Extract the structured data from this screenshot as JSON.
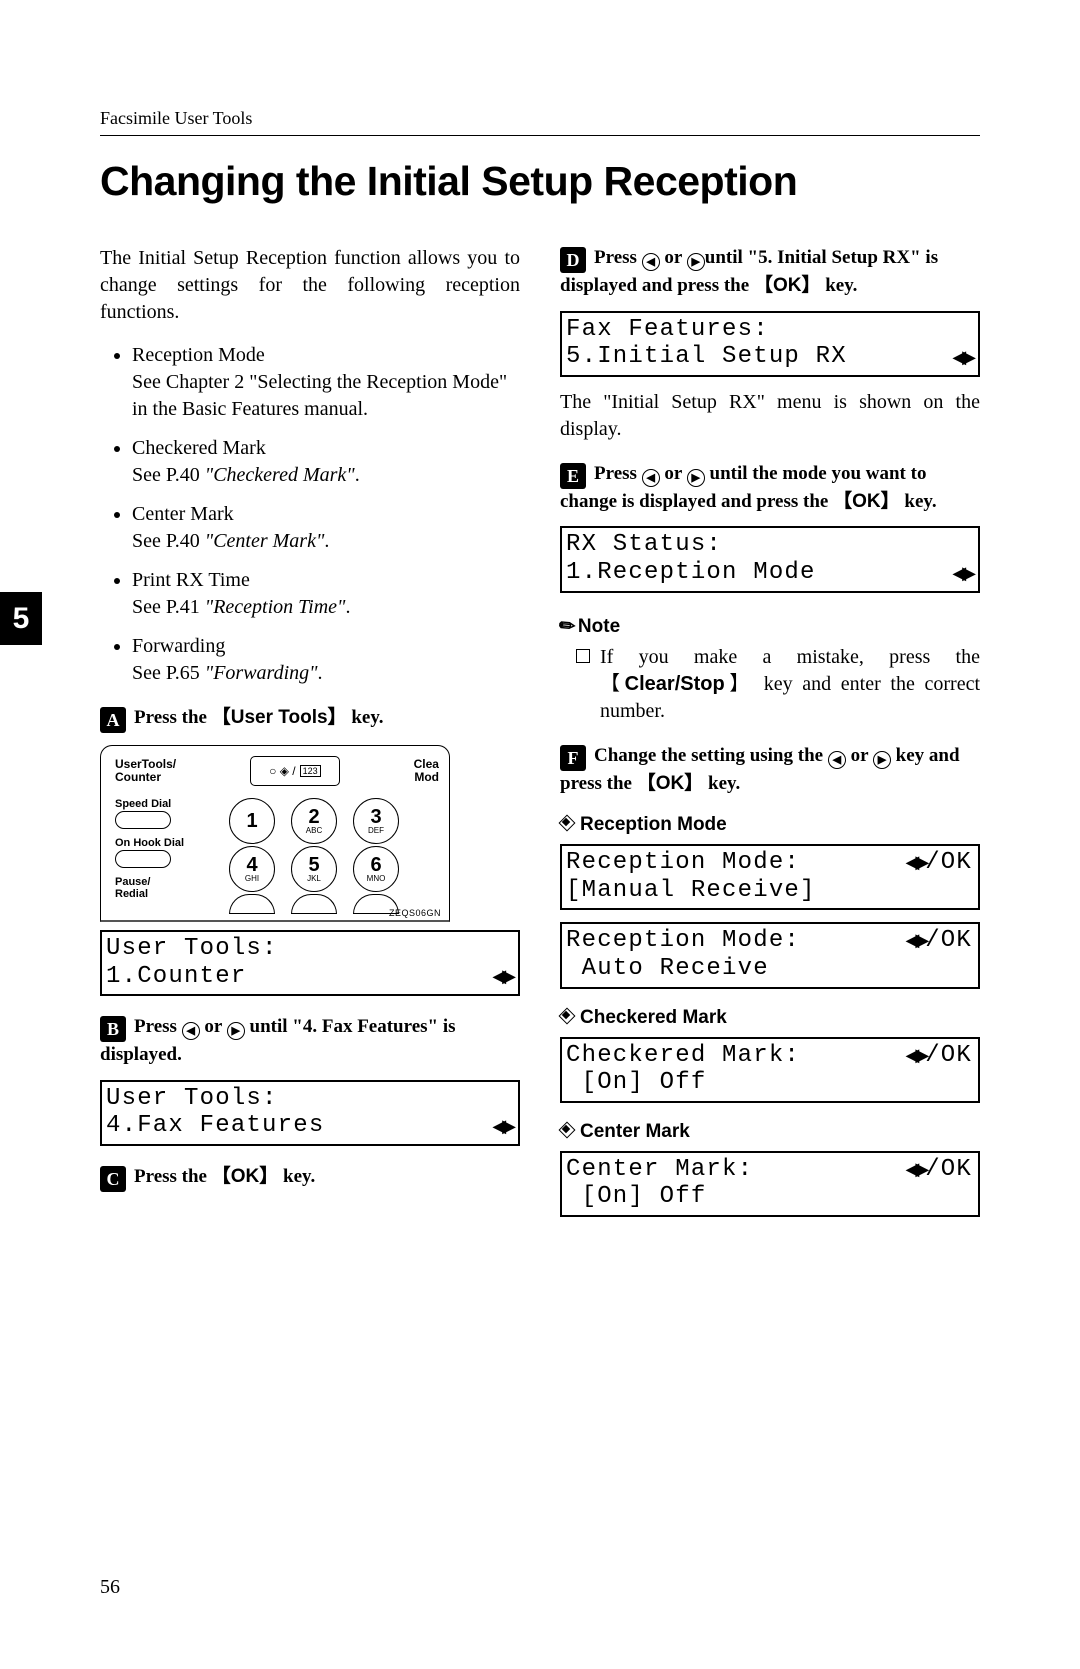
{
  "header": "Facsimile User Tools",
  "title": "Changing the Initial Setup Reception",
  "sideTab": "5",
  "pageNum": "56",
  "intro": "The Initial Setup Reception function allows you to change settings for the following reception functions.",
  "bullets": [
    {
      "t1": "Reception Mode",
      "t2": "See Chapter 2 \"Selecting the Reception Mode\" in the Basic Features manual."
    },
    {
      "t1": "Checkered Mark",
      "t2": "See P.40 ",
      "ref": "\"Checkered Mark\"",
      "t3": "."
    },
    {
      "t1": "Center Mark",
      "t2": "See P.40 ",
      "ref": "\"Center Mark\"",
      "t3": "."
    },
    {
      "t1": "Print RX Time",
      "t2": "See P.41 ",
      "ref": "\"Reception Time\"",
      "t3": "."
    },
    {
      "t1": "Forwarding",
      "t2": "See P.65 ",
      "ref": "\"Forwarding\"",
      "t3": "."
    }
  ],
  "keycaps": {
    "userTools": "User Tools",
    "ok": "OK",
    "clearStop": "Clear/Stop"
  },
  "steps": {
    "s1_a": "Press the ",
    "s1_b": " key.",
    "s2_a": "Press ",
    "s2_b": " or ",
    "s2_c": " until \"4. Fax Features\" is displayed.",
    "s3_a": "Press the ",
    "s3_b": " key.",
    "s4_a": "Press ",
    "s4_b": " or ",
    "s4_c": "until \"5. Initial Setup RX\" is displayed and press the ",
    "s4_d": " key.",
    "s5_a": "Press ",
    "s5_b": " or ",
    "s5_c": " until the mode you want to change is displayed and press the ",
    "s5_d": " key.",
    "s6_a": "Change the setting using the ",
    "s6_b": " or ",
    "s6_c": " key and press the ",
    "s6_d": " key."
  },
  "lcds": {
    "usertools_counter": {
      "l1": "User Tools:",
      "l2": "1.Counter"
    },
    "usertools_fax": {
      "l1": "User Tools:",
      "l2": "4.Fax Features"
    },
    "fax_features": {
      "l1": "Fax Features:",
      "l2": "5.Initial Setup RX"
    },
    "rx_status": {
      "l1": "RX Status:",
      "l2": "1.Reception Mode"
    },
    "rm_manual": {
      "l1": "Reception Mode:",
      "suf": "/OK",
      "l2": "[Manual Receive]"
    },
    "rm_auto": {
      "l1": "Reception Mode:",
      "suf": "/OK",
      "l2": " Auto Receive"
    },
    "checkered": {
      "l1": "Checkered Mark:",
      "suf": "/OK",
      "l2": " [On] Off"
    },
    "center": {
      "l1": "Center Mark:",
      "suf": "/OK",
      "l2": " [On] Off"
    }
  },
  "afterStep4": "The \"Initial Setup RX\" menu is shown on the display.",
  "note": {
    "label": "Note",
    "item_a": "If you make a mistake, press the ",
    "item_b": " key and enter the correct number."
  },
  "subheads": {
    "rm": "Reception Mode",
    "cm": "Checkered Mark",
    "ctm": "Center Mark"
  },
  "panel": {
    "ut": "UserTools/\nCounter",
    "clea": "Clea",
    "mod": "Mod",
    "speed": "Speed Dial",
    "hook": "On Hook Dial",
    "pause": "Pause/\nRedial",
    "figid": "ZEQS06GN",
    "keys": [
      [
        "1",
        ""
      ],
      [
        "2",
        "ABC"
      ],
      [
        "3",
        "DEF"
      ],
      [
        "4",
        "GHI"
      ],
      [
        "5",
        "JKL"
      ],
      [
        "6",
        "MNO"
      ]
    ]
  }
}
